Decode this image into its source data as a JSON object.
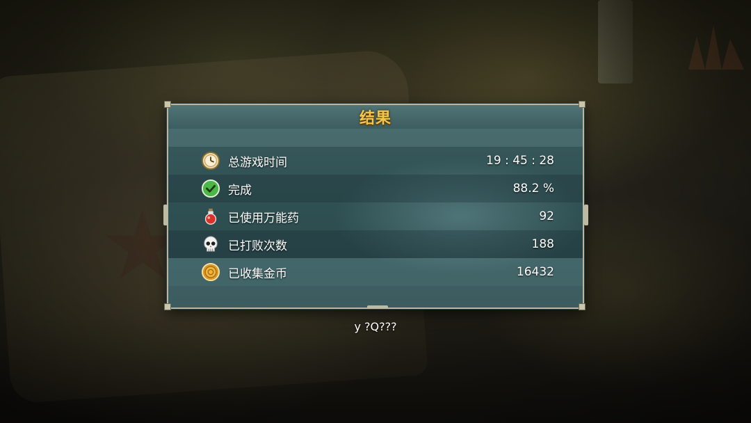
{
  "panel": {
    "title": "结果",
    "rows": [
      {
        "icon": "clock-icon",
        "label": "总游戏时间",
        "value": "19 : 45 : 28"
      },
      {
        "icon": "checkmark-icon",
        "label": "完成",
        "value": "88.2 %"
      },
      {
        "icon": "potion-icon",
        "label": "已使用万能药",
        "value": "92"
      },
      {
        "icon": "skull-icon",
        "label": "已打败次数",
        "value": "188"
      },
      {
        "icon": "gold-coin-icon",
        "label": "已收集金币",
        "value": "16432"
      }
    ]
  },
  "footer": {
    "prompt": "y ?Q???"
  },
  "colors": {
    "title": "#f3c64a",
    "panel": "#2f5052",
    "check": "#4cb648",
    "coin": "#d89a2a",
    "potion": "#d8322a"
  }
}
